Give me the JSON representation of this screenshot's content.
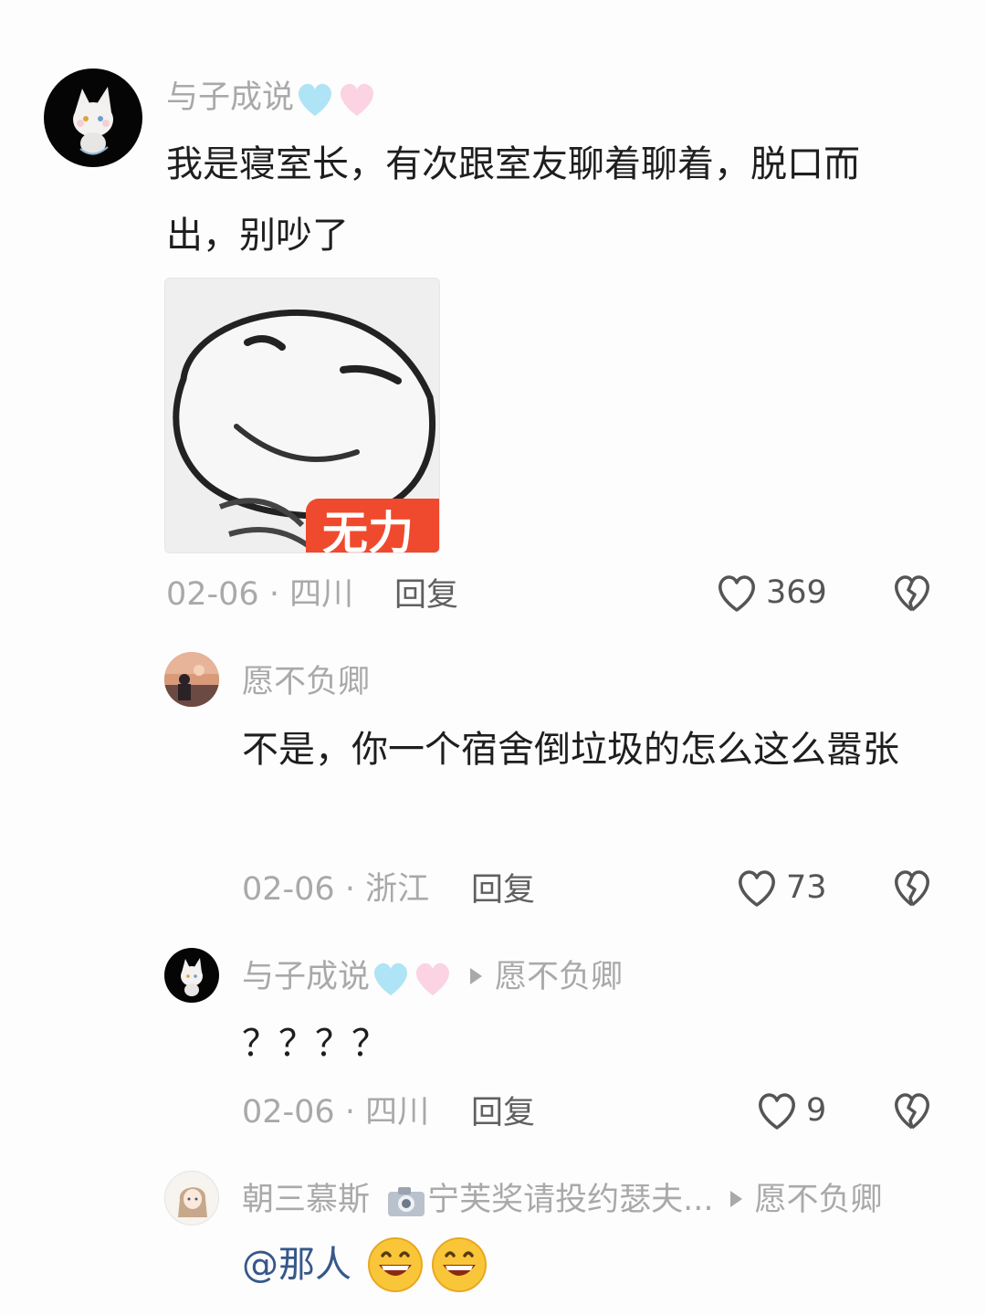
{
  "comments": [
    {
      "author": "与子成说",
      "text": "我是寝室长，有次跟室友聊着聊着，脱口而出，别吵了",
      "sticker_caption": "无力",
      "date": "02-06 · 四川",
      "reply_label": "回复",
      "likes": "369"
    },
    {
      "author": "愿不负卿",
      "text": "不是，你一个宿舍倒垃圾的怎么这么嚣张",
      "date": "02-06 · 浙江",
      "reply_label": "回复",
      "likes": "73"
    },
    {
      "author": "与子成说",
      "reply_to": "愿不负卿",
      "text": "？？？？",
      "date": "02-06 · 四川",
      "reply_label": "回复",
      "likes": "9"
    },
    {
      "author": "朝三慕斯",
      "author_badge": "宁芙奖请投约瑟夫...",
      "reply_to": "愿不负卿",
      "text": "@那人"
    }
  ],
  "colors": {
    "name": "#a9a9a9",
    "text": "#1e1e1e",
    "mention": "#36588a",
    "sticker_badge": "#ef4a2d"
  }
}
